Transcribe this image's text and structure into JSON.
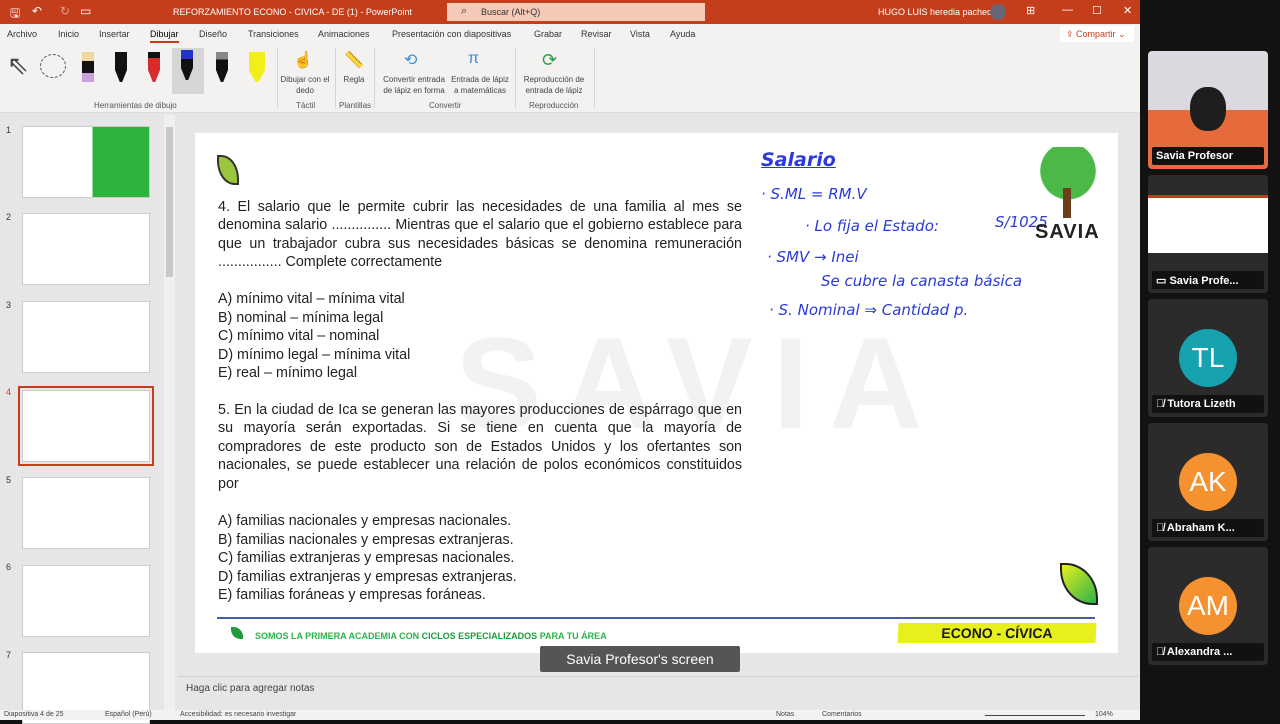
{
  "titlebar": {
    "title": "REFORZAMIENTO ECONO - CIVICA - DE (1)  -  PowerPoint",
    "search": "Buscar (Alt+Q)",
    "user": "HUGO LUIS heredia pacheco"
  },
  "menu": [
    "Archivo",
    "Inicio",
    "Insertar",
    "Dibujar",
    "Diseño",
    "Transiciones",
    "Animaciones",
    "Presentación con diapositivas",
    "Grabar",
    "Revisar",
    "Vista",
    "Ayuda"
  ],
  "share": "Compartir",
  "ribbon": {
    "draw_touch": "Dibujar con el dedo",
    "ruler": "Regla",
    "ink_shape": "Convertir entrada de lápiz en forma",
    "ink_math": "Entrada de lápiz a matemáticas",
    "replay": "Reproducción de entrada de lápiz",
    "groups": {
      "tools": "Herramientas de dibujo",
      "touch": "Táctil",
      "templates": "Plantillas",
      "convert": "Convertir",
      "replay": "Reproducción"
    }
  },
  "thumbs": [
    "1",
    "2",
    "3",
    "4",
    "5",
    "6",
    "7"
  ],
  "slide": {
    "q4": "4. El salario que le permite cubrir las necesidades de una familia al mes se denomina salario ............... Mientras que el salario que el gobierno establece para que un trabajador cubra sus necesidades básicas se denomina remuneración ................ Complete correctamente",
    "q4_opts": [
      "A) mínimo vital – mínima vital",
      "B) nominal – mínima legal",
      "C) mínimo vital – nominal",
      "D) mínimo legal – mínima vital",
      "E) real – mínimo legal"
    ],
    "q5": "5. En la ciudad de Ica se generan las mayores producciones de espárrago que en su mayoría serán exportadas. Si se tiene en cuenta que la mayoría de compradores de este producto son de Estados Unidos y los ofertantes son nacionales, se puede establecer una relación de polos económicos constituidos por",
    "q5_opts": [
      "A) familias nacionales y empresas nacionales.",
      "B) familias nacionales y empresas extranjeras.",
      "C) familias extranjeras y empresas nacionales.",
      "D) familias extranjeras y empresas extranjeras.",
      "E) familias foráneas y empresas foráneas."
    ],
    "handwriting": [
      "Salario",
      "· S.ML = RM.V",
      "· Lo fija el Estado:",
      "S/1025",
      "· SMV → Inei",
      "Se cubre la canasta básica",
      "· S. Nominal ⇒ Cantidad p."
    ],
    "logo": "SAVIA",
    "watermark": "SAVIA",
    "footer_a": "SOMOS LA PRIMERA ACADEMIA CON ",
    "footer_b": "CICLOS ESPECIALIZADOS",
    "footer_c": " PARA TU ÁREA",
    "tag": "ECONO - CÍVICA"
  },
  "notes": "Haga clic para agregar notas",
  "status": {
    "slide": "Diapositiva 4 de 25",
    "lang": "Español (Perú)",
    "access": "Accesibilidad: es necesario investigar",
    "notes": "Notas",
    "comments": "Comentarios",
    "zoom": "104%"
  },
  "share_label": "Savia Profesor's screen",
  "participants": [
    {
      "name": "Savia Profesor",
      "initials": "",
      "color": ""
    },
    {
      "name": "Savia Profe...",
      "initials": "",
      "color": ""
    },
    {
      "name": "Tutora Lizeth",
      "initials": "TL",
      "color": "#17a2b0"
    },
    {
      "name": "Abraham K...",
      "initials": "AK",
      "color": "#f5922f"
    },
    {
      "name": "Alexandra ...",
      "initials": "AM",
      "color": "#f5922f"
    }
  ]
}
